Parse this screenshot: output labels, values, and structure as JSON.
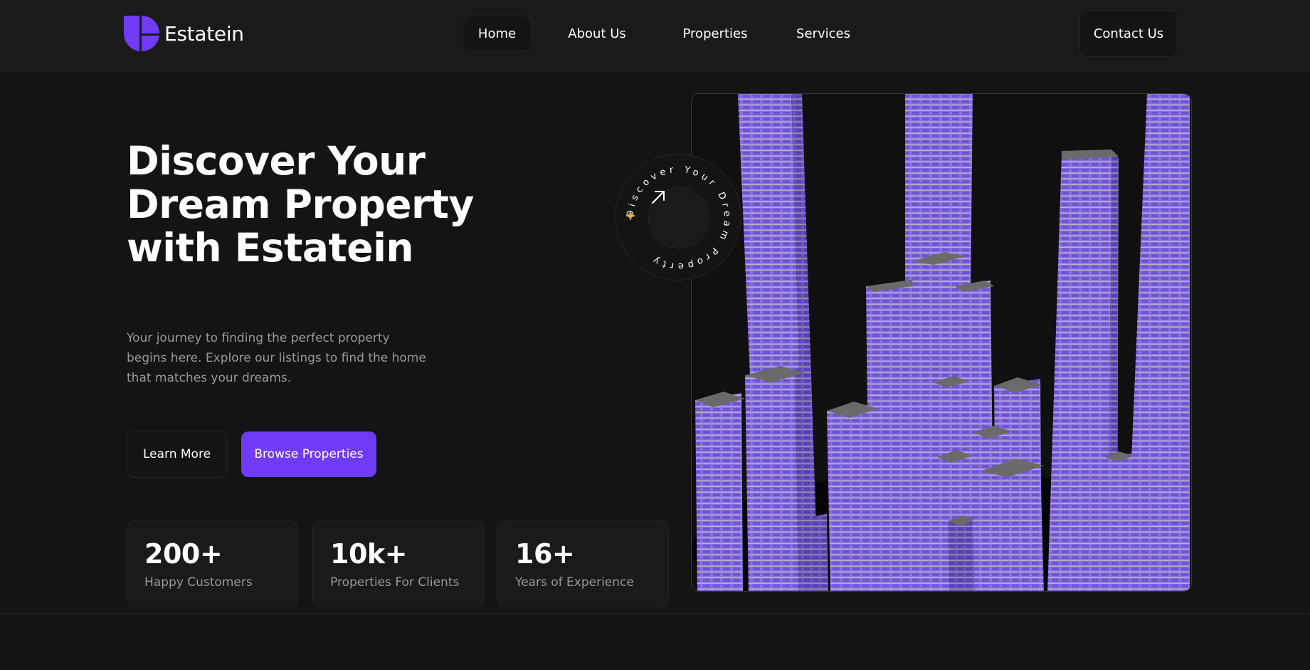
{
  "brand": {
    "name": "Estatein",
    "accent": "#703bf7"
  },
  "nav": {
    "items": [
      {
        "label": "Home",
        "active": true
      },
      {
        "label": "About Us",
        "active": false
      },
      {
        "label": "Properties",
        "active": false
      },
      {
        "label": "Services",
        "active": false
      }
    ],
    "contact_label": "Contact Us"
  },
  "hero": {
    "title": "Discover Your Dream Property with Estatein",
    "description": "Your journey to finding the perfect property begins here. Explore our listings to find the home that matches your dreams.",
    "learn_more_label": "Learn More",
    "browse_label": "Browse Properties"
  },
  "badge": {
    "circular_text": "Discover Your Dream Property",
    "icon": "arrow-up-right-icon"
  },
  "stats": [
    {
      "value": "200+",
      "label": "Happy Customers"
    },
    {
      "value": "10k+",
      "label": "Properties For Clients"
    },
    {
      "value": "16+",
      "label": "Years of Experience"
    }
  ],
  "colors": {
    "background": "#141414",
    "surface": "#1a1a1a",
    "border": "#262626",
    "muted_text": "#999999",
    "building": "#8a6ee8"
  }
}
